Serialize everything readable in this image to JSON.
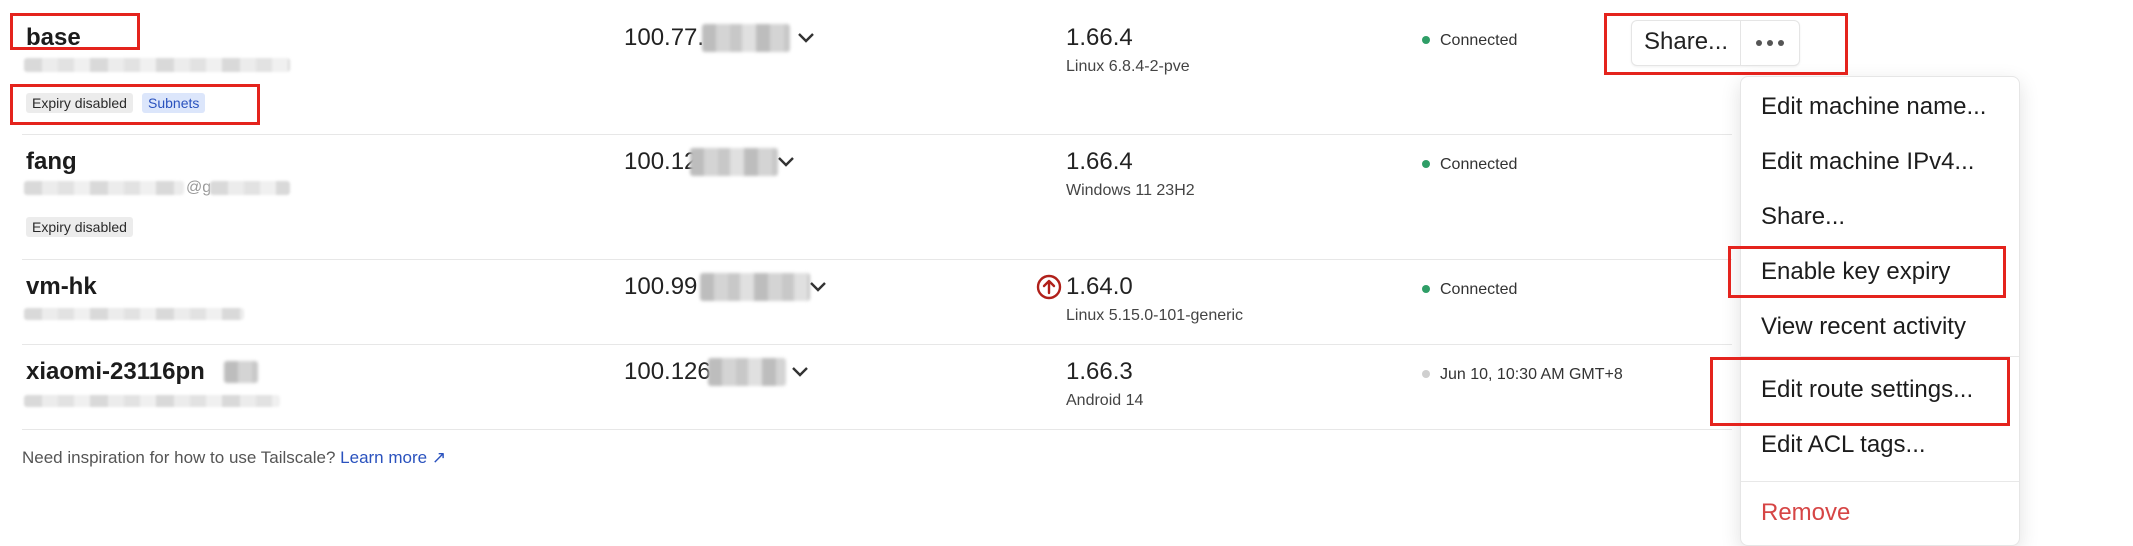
{
  "machines": [
    {
      "name": "base",
      "ip": "100.77.",
      "version": "1.66.4",
      "os": "Linux 6.8.4-2-pve",
      "status": "Connected",
      "badges": [
        "Expiry disabled",
        "Subnets"
      ]
    },
    {
      "name": "fang",
      "ip": "100.12",
      "version": "1.66.4",
      "os": "Windows 11 23H2",
      "status": "Connected",
      "badges": [
        "Expiry disabled"
      ],
      "owner_partial": "@g"
    },
    {
      "name": "vm-hk",
      "ip": "100.99",
      "version": "1.64.0",
      "os": "Linux 5.15.0-101-generic",
      "status": "Connected",
      "badges": []
    },
    {
      "name": "xiaomi-23116pn",
      "ip": "100.126",
      "version": "1.66.3",
      "os": "Android 14",
      "status": "Jun 10, 10:30 AM GMT+8",
      "badges": []
    }
  ],
  "actions": {
    "share_label": "Share...",
    "more_icon": "ellipsis-icon"
  },
  "menu": {
    "items": [
      "Edit machine name...",
      "Edit machine IPv4...",
      "Share...",
      "Enable key expiry",
      "View recent activity",
      "Edit route settings...",
      "Edit ACL tags...",
      "Remove"
    ]
  },
  "footer": {
    "text": "Need inspiration for how to use Tailscale?",
    "link": "Learn more ↗"
  },
  "colors": {
    "connected": "#2f9e67",
    "offline": "#cfcfcf",
    "accent": "#2a52be",
    "danger": "#d64545",
    "highlight": "#e4231d",
    "update": "#b0201a"
  }
}
